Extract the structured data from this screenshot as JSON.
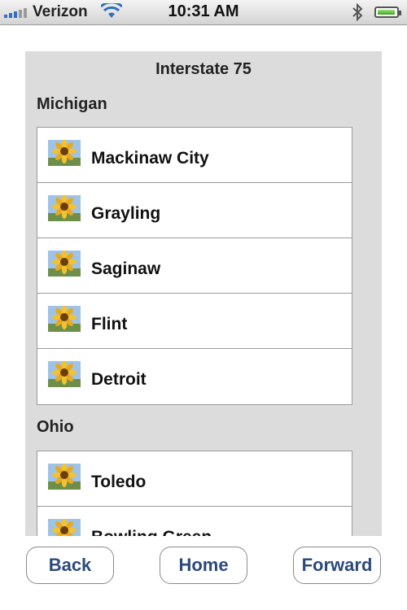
{
  "status_bar": {
    "carrier": "Verizon",
    "time": "10:31 AM"
  },
  "panel": {
    "title": "Interstate 75",
    "sections": [
      {
        "title": "Michigan",
        "items": [
          "Mackinaw City",
          "Grayling",
          "Saginaw",
          "Flint",
          "Detroit"
        ]
      },
      {
        "title": "Ohio",
        "items": [
          "Toledo",
          "Bowling Green"
        ]
      }
    ],
    "item_icon": "sunflower-icon"
  },
  "nav": {
    "back_label": "Back",
    "home_label": "Home",
    "forward_label": "Forward"
  },
  "colors": {
    "panel_bg": "#dcdcdc",
    "button_text": "#2c4a7c",
    "signal_blue": "#2f6fc4"
  }
}
